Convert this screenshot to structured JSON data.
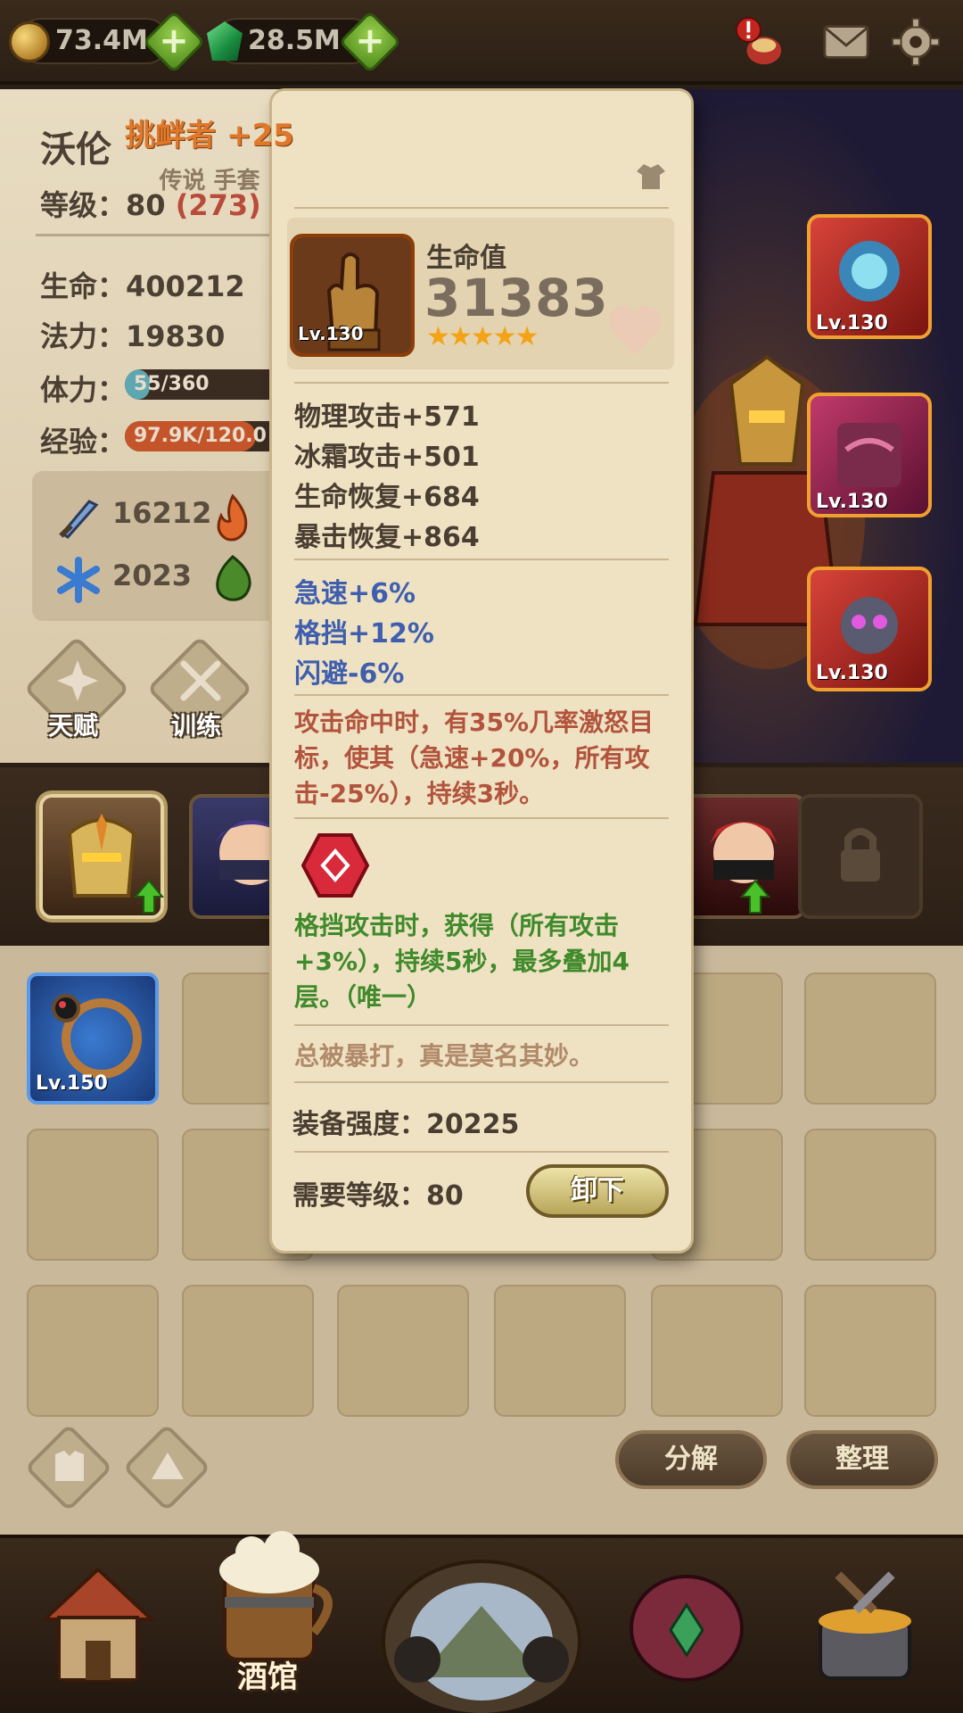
{
  "topbar": {
    "gold": "73.4M",
    "gems": "28.5M",
    "icons": [
      "coin-icon",
      "gem-icon",
      "alert-icon",
      "mail-icon",
      "gear-icon"
    ]
  },
  "character": {
    "name": "沃伦",
    "level_label": "等级：",
    "level": "80",
    "level_extra": "(273)",
    "hp_label": "生命：",
    "hp": "400212",
    "mp_label": "法力：",
    "mp": "19830",
    "stamina_label": "体力：",
    "stamina": "55/360",
    "stamina_fraction": 0.153,
    "exp_label": "经验：",
    "exp": "97.9K/120.0",
    "exp_fraction": 0.816,
    "attack_phys": "16212",
    "attack_ice": "2023",
    "talent_label": "天赋",
    "train_label": "训练"
  },
  "equipped": [
    {
      "level": "Lv.130"
    },
    {
      "level": "Lv.130"
    },
    {
      "level": "Lv.130"
    }
  ],
  "inventory": {
    "first_item_level": "Lv.150",
    "decompose_label": "分解",
    "sort_label": "整理"
  },
  "nav": {
    "tavern_label": "酒馆"
  },
  "item": {
    "title": "挑衅者 +25",
    "subtitle": "传说 手套",
    "main_stat_label": "生命值",
    "main_stat_value": "31383",
    "stars": "★★★★★",
    "level": "Lv.130",
    "stats": [
      "物理攻击+571",
      "冰霜攻击+501",
      "生命恢复+684",
      "暴击恢复+864"
    ],
    "bonus_stats": [
      "急速+6%",
      "格挡+12%",
      "闪避-6%"
    ],
    "effect_text": "攻击命中时，有35%几率激怒目标，使其（急速+20%，所有攻击-25%），持续3秒。",
    "rune_text": "格挡攻击时，获得（所有攻击+3%），持续5秒，最多叠加4层。（唯一）",
    "flavor_text": "总被暴打，真是莫名其妙。",
    "power_label": "装备强度：",
    "power_value": "20225",
    "req_label": "需要等级：",
    "req_value": "80",
    "unequip_label": "卸下"
  },
  "colors": {
    "card_bg": "#efe2c3",
    "title_orange": "#e0782b",
    "bonus_blue": "#3f5fae",
    "effect_red": "#b2543d",
    "rune_green": "#3f8a2a"
  }
}
